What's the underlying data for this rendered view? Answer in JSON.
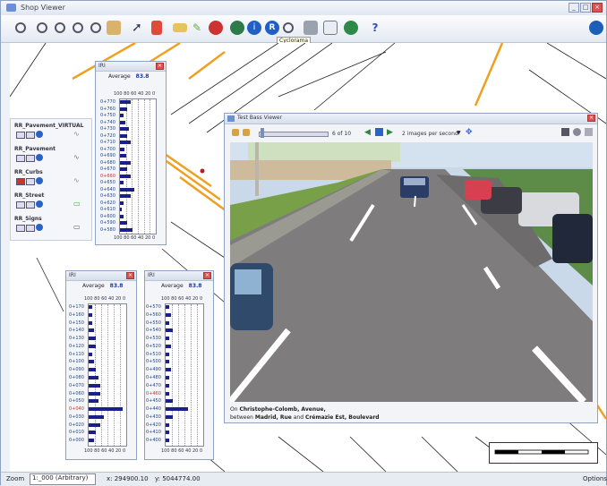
{
  "app": {
    "title": "Shop Viewer"
  },
  "toolbar": {
    "tooltip": "Cyclorama",
    "help": "?",
    "icons": [
      "zoom-in-icon",
      "zoom-out-icon",
      "zoom-extent-icon",
      "zoom-prev-icon",
      "zoom-next-icon",
      "pan-icon",
      "select-icon",
      "measure-icon",
      "layer-icon",
      "identify-icon",
      "cyclorama-icon",
      "search-icon",
      "print-icon",
      "globe-icon",
      "help-icon"
    ]
  },
  "layers": [
    {
      "name": "RR_Pavement_VIRTUAL"
    },
    {
      "name": "RR_Pavement"
    },
    {
      "name": "RR_Curbs"
    },
    {
      "name": "RR_Street"
    },
    {
      "name": "RR_Signs"
    }
  ],
  "panel_top": {
    "title": "IRI",
    "average_label": "Average",
    "average_value": "83.8",
    "ticks": "100 80 60 40 20 0",
    "rows": [
      "0+770",
      "0+760",
      "0+750",
      "0+740",
      "0+730",
      "0+720",
      "0+710",
      "0+700",
      "0+690",
      "0+680",
      "0+670",
      "0+660",
      "0+650",
      "0+640",
      "0+630",
      "0+620",
      "0+610",
      "0+600",
      "0+590",
      "0+580"
    ],
    "values": [
      30,
      20,
      10,
      15,
      25,
      20,
      30,
      12,
      18,
      30,
      20,
      30,
      10,
      40,
      30,
      10,
      5,
      10,
      20,
      35
    ]
  },
  "panel_bl": {
    "title": "IRI",
    "average_label": "Average",
    "average_value": "83.8",
    "ticks": "100 80 60 40 20 0",
    "rows": [
      "0+170",
      "0+160",
      "0+150",
      "0+140",
      "0+130",
      "0+120",
      "0+110",
      "0+100",
      "0+090",
      "0+080",
      "0+070",
      "0+060",
      "0+050",
      "0+040",
      "0+030",
      "0+020",
      "0+010",
      "0+000"
    ],
    "values": [
      10,
      10,
      10,
      15,
      20,
      20,
      10,
      15,
      20,
      25,
      30,
      30,
      25,
      90,
      40,
      30,
      20,
      15
    ]
  },
  "panel_br": {
    "title": "IRI",
    "average_label": "Average",
    "average_value": "83.8",
    "ticks": "100 80 60 40 20 0",
    "rows": [
      "0+570",
      "0+560",
      "0+550",
      "0+540",
      "0+530",
      "0+520",
      "0+510",
      "0+500",
      "0+490",
      "0+480",
      "0+470",
      "0+460",
      "0+450",
      "0+440",
      "0+430",
      "0+420",
      "0+410",
      "0+400"
    ],
    "values": [
      10,
      15,
      10,
      20,
      10,
      15,
      10,
      10,
      15,
      10,
      10,
      10,
      20,
      60,
      20,
      10,
      10,
      10
    ]
  },
  "viewer": {
    "title": "Test Bass Viewer",
    "frame": "6 of 10",
    "speed": "2 images per second",
    "caption_line1_prefix": "On ",
    "caption_line1_bold": "Christophe-Colomb, Avenue,",
    "caption_line2_prefix": "between ",
    "caption_line2_a": "Madrid, Rue",
    "caption_line2_and": " and ",
    "caption_line2_b": "Crémazie Est, Boulevard"
  },
  "status": {
    "zoom_label": "Zoom",
    "zoom_value": "1:_000 (Arbitrary)",
    "coord_x": "x: 294900.10",
    "coord_y": "y: 5044774.00",
    "options": "Options"
  }
}
